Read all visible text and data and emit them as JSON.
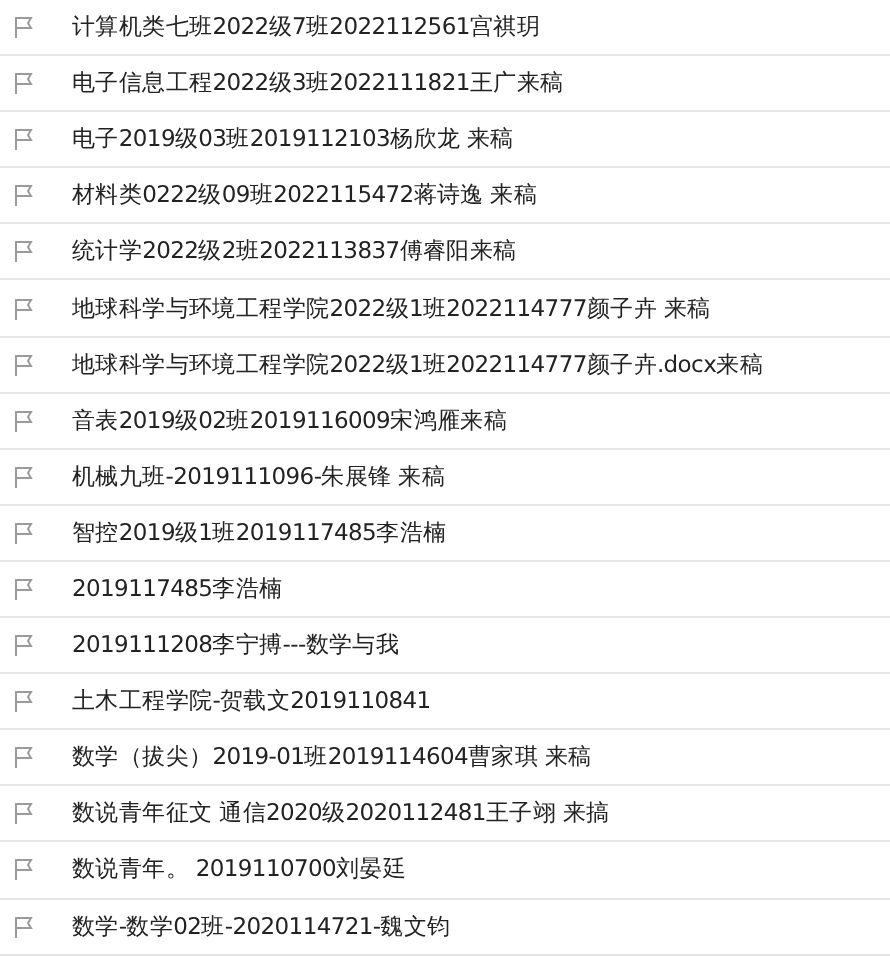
{
  "messages": [
    {
      "subject": "计算机类七班2022级7班2022112561宫祺玥"
    },
    {
      "subject": "电子信息工程2022级3班2022111821王广来稿"
    },
    {
      "subject": "电子2019级03班2019112103杨欣龙 来稿"
    },
    {
      "subject": "材料类0222级09班2022115472蒋诗逸 来稿"
    },
    {
      "subject": "统计学2022级2班2022113837傅睿阳来稿"
    },
    {
      "subject": "地球科学与环境工程学院2022级1班2022114777颜子卉 来稿"
    },
    {
      "subject": "地球科学与环境工程学院2022级1班2022114777颜子卉.docx来稿"
    },
    {
      "subject": "音表2019级02班2019116009宋鸿雁来稿"
    },
    {
      "subject": "机械九班-2019111096-朱展锋 来稿"
    },
    {
      "subject": "智控2019级1班2019117485李浩楠"
    },
    {
      "subject": "2019117485李浩楠"
    },
    {
      "subject": "2019111208李宁搏---数学与我"
    },
    {
      "subject": "土木工程学院-贺载文2019110841"
    },
    {
      "subject": "数学（拔尖）2019-01班2019114604曹家琪 来稿"
    },
    {
      "subject": "数说青年征文 通信2020级2020112481王子翊 来搞"
    },
    {
      "subject": "数说青年。 2019110700刘晏廷"
    },
    {
      "subject": "数学-数学02班-2020114721-魏文钧"
    }
  ]
}
